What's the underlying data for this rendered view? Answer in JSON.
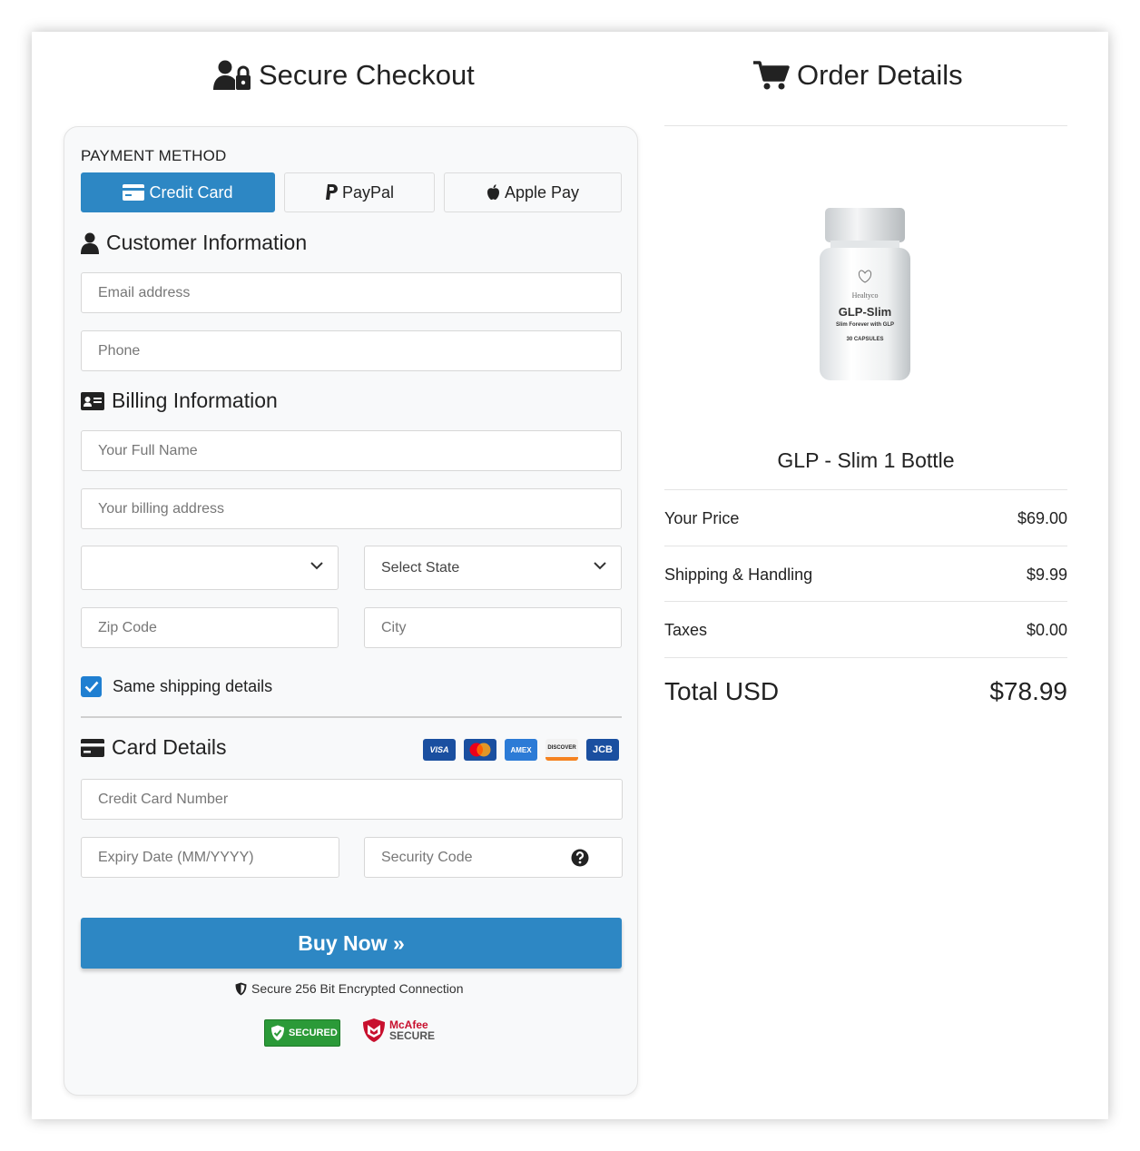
{
  "header": {
    "checkout_title": "Secure Checkout",
    "order_title": "Order Details"
  },
  "payment": {
    "label": "PAYMENT METHOD",
    "tabs": [
      "Credit Card",
      "PayPal",
      "Apple Pay"
    ],
    "active_tab": "Credit Card"
  },
  "customer": {
    "title": "Customer Information",
    "email_placeholder": "Email address",
    "phone_placeholder": "Phone"
  },
  "billing": {
    "title": "Billing Information",
    "name_placeholder": "Your Full Name",
    "address_placeholder": "Your billing address",
    "country_value": "",
    "state_value": "Select State",
    "zip_placeholder": "Zip Code",
    "city_placeholder": "City",
    "same_shipping_label": "Same shipping details",
    "same_shipping_checked": true
  },
  "card": {
    "title": "Card Details",
    "logos": [
      "VISA",
      "mastercard",
      "AMEX",
      "DISCOVER",
      "JCB"
    ],
    "number_placeholder": "Credit Card Number",
    "expiry_placeholder": "Expiry Date (MM/YYYY)",
    "cvv_placeholder": "Security Code"
  },
  "actions": {
    "buy_label": "Buy Now »",
    "secure_note": "Secure 256 Bit Encrypted Connection",
    "badge_secured": "SECURED",
    "badge_mcafee_line1": "McAfee",
    "badge_mcafee_line2": "SECURE"
  },
  "order": {
    "product_name": "GLP - Slim 1 Bottle",
    "bottle_label_brand": "Healtyco",
    "bottle_label_name": "GLP-Slim",
    "bottle_label_tag": "Slim Forever with GLP",
    "bottle_label_count": "30 CAPSULES",
    "lines": [
      {
        "label": "Your Price",
        "value": "$69.00"
      },
      {
        "label": "Shipping & Handling",
        "value": "$9.99"
      },
      {
        "label": "Taxes",
        "value": "$0.00"
      }
    ],
    "total_label": "Total USD",
    "total_value": "$78.99"
  },
  "colors": {
    "accent": "#2d87c4",
    "checkbox": "#1f7fd1",
    "card_bg": "#f8f9fa"
  }
}
